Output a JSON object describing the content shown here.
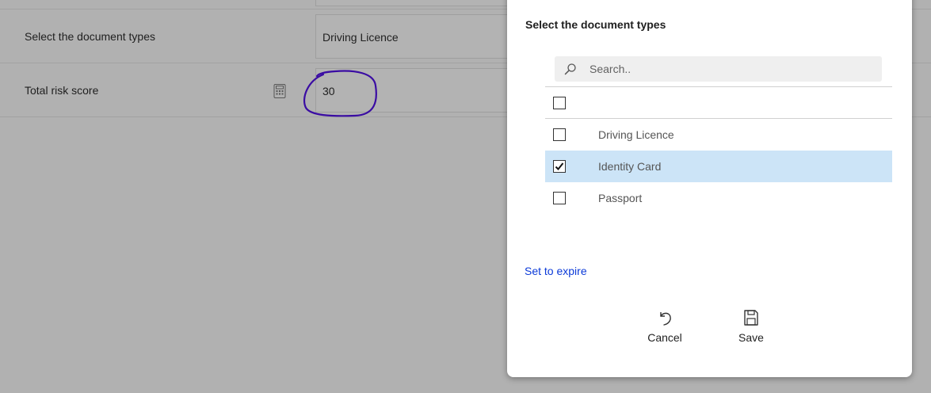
{
  "form": {
    "doc_types_label": "Select the document types",
    "doc_types_value": "Driving Licence",
    "risk_label": "Total risk score",
    "risk_value": "30",
    "risk_icon": "calculator-icon"
  },
  "dialog": {
    "title": "Select the document types",
    "search_placeholder": "Search..",
    "select_all_checked": false,
    "options": [
      {
        "label": "Driving Licence",
        "checked": false,
        "selected": false
      },
      {
        "label": "Identity Card",
        "checked": true,
        "selected": true
      },
      {
        "label": "Passport",
        "checked": false,
        "selected": false
      }
    ],
    "expire_link": "Set to expire",
    "cancel_label": "Cancel",
    "save_label": "Save"
  },
  "colors": {
    "overlay": "#b1b1b1",
    "selected_row": "#cce4f7",
    "link": "#0b3ad8",
    "annotation": "#3a0ca3"
  }
}
